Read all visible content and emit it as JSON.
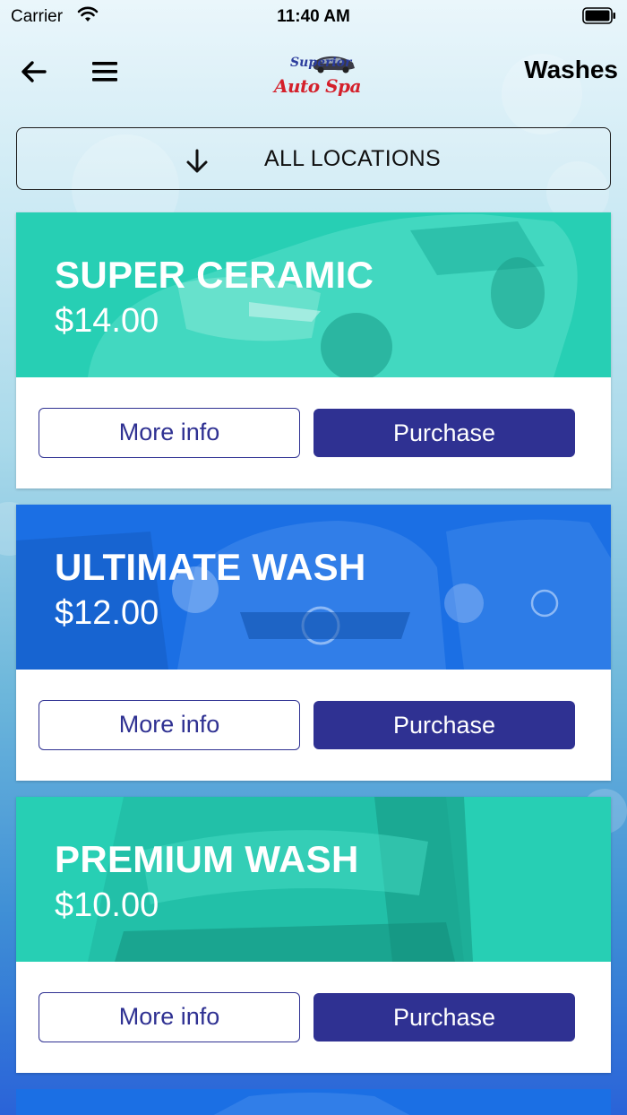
{
  "status_bar": {
    "carrier": "Carrier",
    "time": "11:40 AM"
  },
  "nav": {
    "title": "Washes",
    "logo_line1": "Superior",
    "logo_line2": "Auto Spa",
    "back_icon": "arrow-left-icon",
    "menu_icon": "hamburger-menu-icon"
  },
  "location_filter": {
    "label": "ALL LOCATIONS",
    "icon": "arrow-down-icon"
  },
  "colors": {
    "teal": "#27cfb4",
    "blue": "#1b6fe4",
    "button_indigo": "#2f3192"
  },
  "washes": [
    {
      "name": "SUPER CERAMIC",
      "price": "$14.00",
      "more_info_label": "More info",
      "purchase_label": "Purchase",
      "color": "#27cfb4"
    },
    {
      "name": "ULTIMATE WASH",
      "price": "$12.00",
      "more_info_label": "More info",
      "purchase_label": "Purchase",
      "color": "#1b6fe4"
    },
    {
      "name": "PREMIUM WASH",
      "price": "$10.00",
      "more_info_label": "More info",
      "purchase_label": "Purchase",
      "color": "#27cfb4"
    }
  ]
}
